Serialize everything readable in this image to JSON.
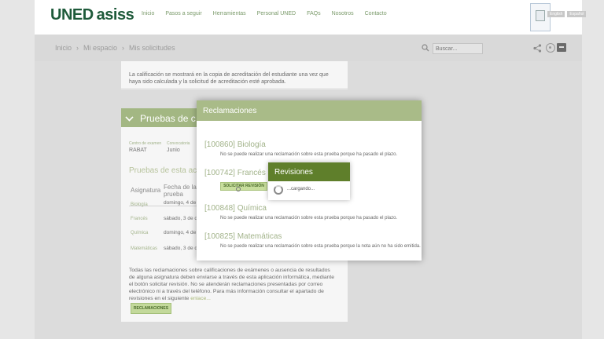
{
  "header": {
    "logo_prefix": "UNED",
    "logo_suffix": "asiss",
    "nav": [
      "Inicio",
      "Pasos a seguir",
      "Herramientas",
      "Personal UNED",
      "FAQs",
      "Nosotros",
      "Contacto"
    ],
    "lang": [
      "English",
      "Español"
    ]
  },
  "subbar": {
    "breadcrumb": [
      "Inicio",
      "Mi espacio",
      "Mis solicitudes"
    ],
    "search_placeholder": "Buscar..."
  },
  "info_card": {
    "text": "La calificación se mostrará en la copia de acreditación del estudiante una vez que haya sido calculada y la solicitud de acreditación esté aprobada."
  },
  "pruebas": {
    "title": "Pruebas de c",
    "meta": [
      {
        "label": "Centro de examen",
        "value": "RABAT"
      },
      {
        "label": "Convocatoria",
        "value": "Junio"
      }
    ],
    "subtitle": "Pruebas de esta ac",
    "headers": {
      "asignatura": "Asignatura",
      "fecha": "Fecha de la prueba"
    },
    "rows": [
      {
        "subject": "Biología",
        "date": "domingo, 4 de de 2017 a las 1"
      },
      {
        "subject": "Francés",
        "date": "sábado, 3 de de 2017 a las 1"
      },
      {
        "subject": "Química",
        "date": "domingo, 4 de de 2017 a las 1"
      },
      {
        "subject": "Matemáticas",
        "date": "sábado, 3 de de 2017 a las 1"
      }
    ],
    "footnote": "Todas las reclamaciones sobre calificaciones de exámenes o ausencia de resultados de alguna asignatura deben enviarse a través de esta aplicación informática, mediante el botón solicitar revisión. No se atenderán reclamaciones presentadas por correo electrónico ni a través del teléfono. Para más información consultar el apartado de revisiones en el siguiente",
    "footnote_link": "enlace...",
    "reclamaciones_button": "RECLAMACIONES"
  },
  "modal": {
    "title": "Reclamaciones",
    "items": [
      {
        "subject": "[100860] Biología",
        "message": "No se puede realizar una reclamación sobre esta prueba porque ha pasado el plazo."
      },
      {
        "subject": "[100742] Francés",
        "button": "SOLICITAR REVISIÓN"
      },
      {
        "subject": "[100848] Química",
        "message": "No se puede realizar una reclamación sobre esta prueba porque ha pasado el plazo."
      },
      {
        "subject": "[100825] Matemáticas",
        "message": "No se puede realizar una reclamación sobre esta prueba porque la nota aún no ha sido emitida."
      }
    ]
  },
  "popup": {
    "title": "Revisiones",
    "loading": "...cargando..."
  },
  "colors": {
    "brand_green": "#1e5a3a",
    "accent_green": "#a9bb88",
    "dark_green": "#5f7f2b",
    "button_green": "#c8de9d"
  }
}
